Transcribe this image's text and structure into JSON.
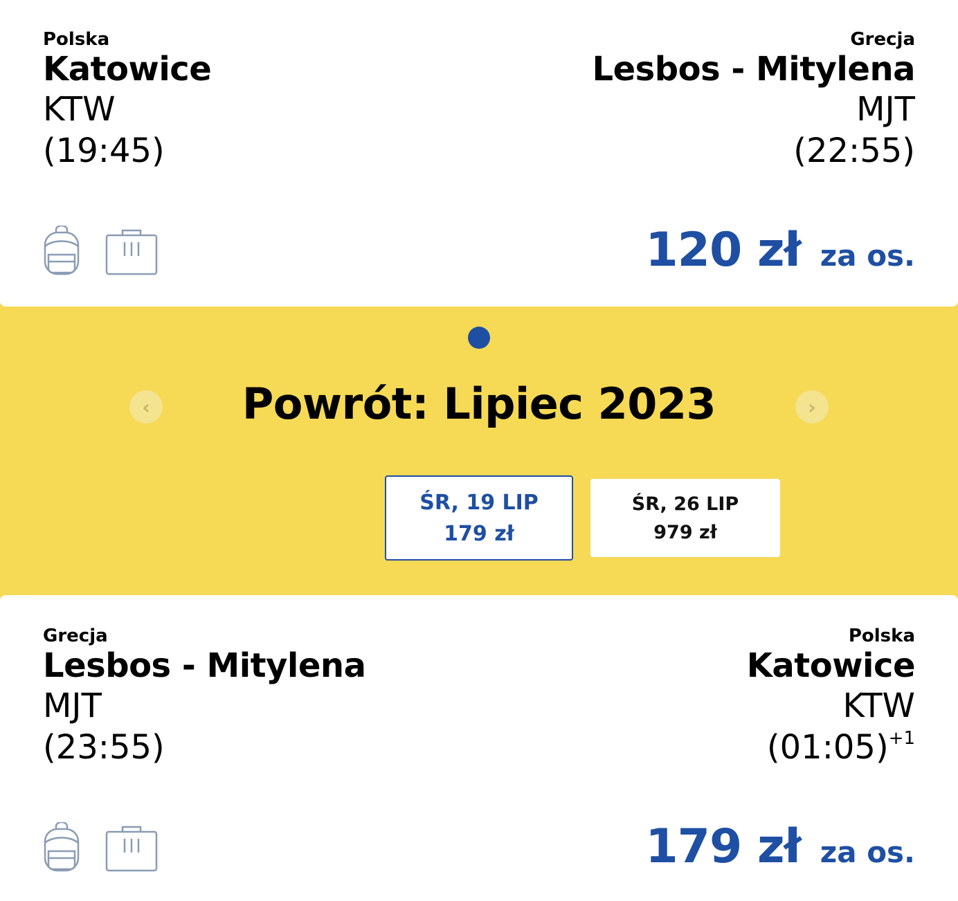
{
  "outbound": {
    "origin": {
      "country": "Polska",
      "city": "Katowice",
      "code": "KTW",
      "time": "(19:45)"
    },
    "destination": {
      "country": "Grecja",
      "city": "Lesbos - Mitylena",
      "code": "MJT",
      "time": "(22:55)"
    },
    "price": "120 zł",
    "per_person": "za os.",
    "icons": [
      "backpack-icon",
      "suitcase-icon"
    ]
  },
  "return_section": {
    "title": "Powrót: Lipiec 2023",
    "prev_icon": "chevron-left-icon",
    "next_icon": "chevron-right-icon",
    "dates": [
      {
        "day": "ŚR, 19 LIP",
        "price": "179 zł",
        "selected": true
      },
      {
        "day": "ŚR, 26 LIP",
        "price": "979 zł",
        "selected": false
      }
    ]
  },
  "return_flight": {
    "origin": {
      "country": "Grecja",
      "city": "Lesbos - Mitylena",
      "code": "MJT",
      "time": "(23:55)"
    },
    "destination": {
      "country": "Polska",
      "city": "Katowice",
      "code": "KTW",
      "time": "(01:05)",
      "day_offset": "+1"
    },
    "price": "179 zł",
    "per_person": "za os.",
    "icons": [
      "backpack-icon",
      "suitcase-icon"
    ]
  },
  "colors": {
    "accent": "#1e4fa3",
    "background_yellow": "#f6d955",
    "card": "#ffffff",
    "icon_gray": "#8a9cb4"
  }
}
